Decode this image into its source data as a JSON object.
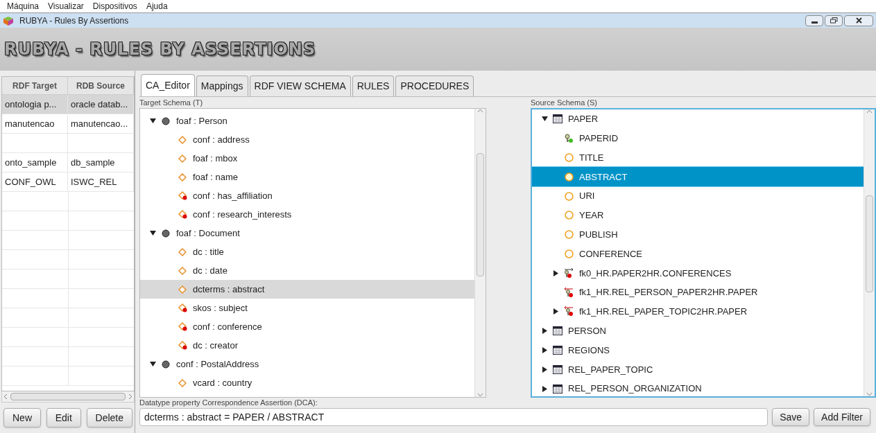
{
  "menu": [
    "Máquina",
    "Visualizar",
    "Dispositivos",
    "Ajuda"
  ],
  "window": {
    "title": "RUBYA - Rules By Assertions"
  },
  "banner": "RUBYA - RULES BY ASSERTIONS",
  "left_table": {
    "columns": [
      "RDF Target",
      "RDB Source"
    ],
    "rows": [
      {
        "cells": [
          "ontologia p...",
          "oracle datab..."
        ],
        "selected": true
      },
      {
        "cells": [
          "manutencao",
          "manutencao..."
        ],
        "selected": false
      },
      {
        "selected": false
      },
      {
        "cells": [
          "onto_sample",
          "db_sample"
        ],
        "selected": false
      },
      {
        "cells": [
          "CONF_OWL",
          "ISWC_REL"
        ],
        "selected": false
      }
    ]
  },
  "left_buttons": [
    "New",
    "Edit",
    "Delete"
  ],
  "tabs": [
    {
      "label": "CA_Editor",
      "selected": true
    },
    {
      "label": "Mappings",
      "selected": false
    },
    {
      "label": "RDF VIEW SCHEMA",
      "selected": false
    },
    {
      "label": "RULES",
      "selected": false
    },
    {
      "label": "PROCEDURES",
      "selected": false
    }
  ],
  "target_schema": {
    "label": "Target Schema (T)",
    "tree": [
      {
        "label": "foaf : Person",
        "kind": "class",
        "expanded": true,
        "selected": false,
        "children": [
          {
            "label": "conf : address",
            "kind": "datatype",
            "selected": false
          },
          {
            "label": "foaf : mbox",
            "kind": "datatype",
            "selected": false
          },
          {
            "label": "foaf : name",
            "kind": "datatype",
            "selected": false
          },
          {
            "label": "conf : has_affiliation",
            "kind": "object",
            "selected": false
          },
          {
            "label": "conf : research_interests",
            "kind": "object",
            "selected": false
          }
        ]
      },
      {
        "label": "foaf : Document",
        "kind": "class",
        "expanded": true,
        "selected": false,
        "children": [
          {
            "label": "dc : title",
            "kind": "datatype",
            "selected": false
          },
          {
            "label": "dc : date",
            "kind": "datatype",
            "selected": false
          },
          {
            "label": "dcterms : abstract",
            "kind": "datatype",
            "selected": true
          },
          {
            "label": "skos : subject",
            "kind": "object",
            "selected": false
          },
          {
            "label": "conf : conference",
            "kind": "object",
            "selected": false
          },
          {
            "label": "dc : creator",
            "kind": "object",
            "selected": false
          }
        ]
      },
      {
        "label": "conf : PostalAddress",
        "kind": "class",
        "expanded": true,
        "selected": false,
        "children": [
          {
            "label": "vcard : country",
            "kind": "datatype",
            "selected": false
          }
        ]
      }
    ]
  },
  "source_schema": {
    "label": "Source Schema (S)",
    "tree": [
      {
        "label": "PAPER",
        "kind": "table",
        "expanded": true,
        "selected": false,
        "children": [
          {
            "label": "PAPERID",
            "kind": "primary_key",
            "selected": false
          },
          {
            "label": "TITLE",
            "kind": "column",
            "selected": false
          },
          {
            "label": "ABSTRACT",
            "kind": "column",
            "selected": true
          },
          {
            "label": "URI",
            "kind": "column",
            "selected": false
          },
          {
            "label": "YEAR",
            "kind": "column",
            "selected": false
          },
          {
            "label": "PUBLISH",
            "kind": "column",
            "selected": false
          },
          {
            "label": "CONFERENCE",
            "kind": "column",
            "selected": false
          },
          {
            "label": "fk0_HR.PAPER2HR.CONFERENCES",
            "kind": "foreign_key_out",
            "expanded": false,
            "selected": false
          },
          {
            "label": "fk1_HR.REL_PERSON_PAPER2HR.PAPER",
            "kind": "foreign_key_in",
            "selected": false
          },
          {
            "label": "fk1_HR.REL_PAPER_TOPIC2HR.PAPER",
            "kind": "foreign_key_in",
            "expanded": false,
            "selected": false
          }
        ]
      },
      {
        "label": "PERSON",
        "kind": "table",
        "expanded": false,
        "selected": false
      },
      {
        "label": "REGIONS",
        "kind": "table",
        "expanded": false,
        "selected": false
      },
      {
        "label": "REL_PAPER_TOPIC",
        "kind": "table",
        "expanded": false,
        "selected": false
      },
      {
        "label": "REL_PERSON_ORGANIZATION",
        "kind": "table",
        "expanded": false,
        "selected": false
      }
    ]
  },
  "assertion": {
    "label": "Datatype property Correspondence Assertion (DCA):",
    "value": "dcterms : abstract = PAPER / ABSTRACT"
  },
  "assertion_buttons": [
    "Save",
    "Add Filter"
  ]
}
